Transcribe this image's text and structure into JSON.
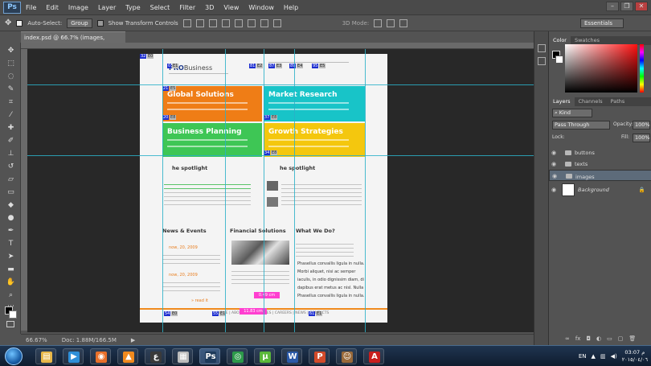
{
  "menubar": {
    "logo": "Ps",
    "items": [
      "File",
      "Edit",
      "Image",
      "Layer",
      "Type",
      "Select",
      "Filter",
      "3D",
      "View",
      "Window",
      "Help"
    ],
    "window_controls": [
      "–",
      "❐",
      "✕"
    ]
  },
  "options": {
    "auto_select_label": "Auto-Select:",
    "auto_select_value": "Group",
    "show_transform_label": "Show Transform Controls",
    "mode_3d_label": "3D Mode:",
    "workspace": "Essentials"
  },
  "document": {
    "tab_title": "index.psd @ 66.7% (images, RGB/8) *",
    "close": "×"
  },
  "canvas": {
    "logo_brand": "PRO",
    "logo_suffix": "Business",
    "tiles": [
      {
        "title": "Global Solutions",
        "color": "#ef7d16"
      },
      {
        "title": "Market Research",
        "color": "#18c4c8"
      },
      {
        "title": "Business Planning",
        "color": "#3ec655"
      },
      {
        "title": "Growth Strategies",
        "color": "#f4c70e"
      }
    ],
    "spotlight_left": "he spotlight",
    "spotlight_right": "he spotlight",
    "news_title": "News & Events",
    "financial_title": "Financial Solutions",
    "whatwedo_title": "What We Do?",
    "news_date_1": "now, 20, 2009",
    "news_date_2": "now, 20, 2009",
    "read_more": "» read it",
    "bullets": [
      "Phasellus convallis ligula in nulla.",
      "Morbi aliquet, nisi ac semper",
      "iaculis, in odio dignissim diam, di",
      "dapibus erat metus ac nisl. Nulla",
      "Phasellus convallis ligula in nulla."
    ],
    "footer_links": "HOME | ABOUT US | SERVICES | CAREERS | NEWS | CONTACTS",
    "pink_label_1": "0.49 cm",
    "pink_label_2": "11.83 cm",
    "badges_top": [
      "32",
      "E0",
      "0",
      "E1",
      "81",
      "E2",
      "87",
      "E3",
      "89",
      "E4",
      "95",
      "E5"
    ],
    "badges_mid": [
      "21",
      "E5",
      "20",
      "E8",
      "37",
      "E8",
      "34",
      "E8"
    ],
    "badges_bottom": [
      "54",
      "E0",
      "55",
      "E1",
      "61",
      "E1"
    ]
  },
  "status": {
    "zoom": "66.67%",
    "doc_size": "Doc: 1.88M/166.5M",
    "arrow": "▶"
  },
  "panels": {
    "color_tabs": [
      "Color",
      "Swatches"
    ],
    "layer_tabs": [
      "Layers",
      "Channels",
      "Paths"
    ],
    "kind_label": "Kind",
    "blend_mode": "Pass Through",
    "opacity_label": "Opacity:",
    "opacity_value": "100%",
    "lock_label": "Lock:",
    "fill_label": "Fill:",
    "fill_value": "100%",
    "layers": [
      "buttons",
      "texts",
      "images",
      "Background"
    ]
  },
  "taskbar": {
    "language": "EN",
    "time": "03:07 م",
    "date": "٢٠١٥/٠٤/٠٦",
    "apps": [
      {
        "name": "explorer",
        "glyph": "▤",
        "color": "#e8b84a"
      },
      {
        "name": "media-player",
        "glyph": "▶",
        "color": "#2f8fd8"
      },
      {
        "name": "firefox",
        "glyph": "◉",
        "color": "#e8702a"
      },
      {
        "name": "vlc",
        "glyph": "▲",
        "color": "#f08a1e"
      },
      {
        "name": "arabic-app",
        "glyph": "ع",
        "color": "#3a3a3a"
      },
      {
        "name": "calculator",
        "glyph": "▦",
        "color": "#bbbbbb"
      },
      {
        "name": "photoshop",
        "glyph": "Ps",
        "color": "#1d3a5a"
      },
      {
        "name": "chrome",
        "glyph": "◎",
        "color": "#2c9a4a"
      },
      {
        "name": "utorrent",
        "glyph": "μ",
        "color": "#5ab83a"
      },
      {
        "name": "word",
        "glyph": "W",
        "color": "#2b5aa8"
      },
      {
        "name": "powerpoint",
        "glyph": "P",
        "color": "#d24a2a"
      },
      {
        "name": "user-app",
        "glyph": "☺",
        "color": "#9a6a3a"
      },
      {
        "name": "acrobat",
        "glyph": "A",
        "color": "#c81e1e"
      }
    ]
  }
}
